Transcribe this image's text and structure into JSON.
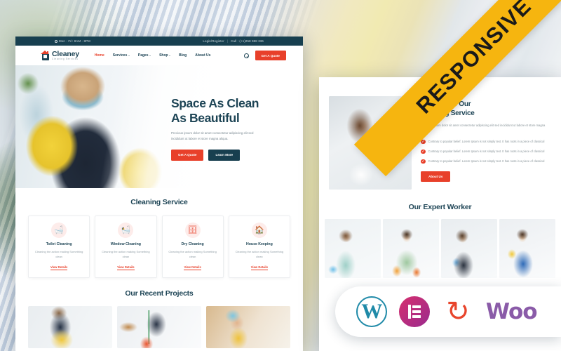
{
  "ribbon": {
    "label": "RESPONSIVE"
  },
  "topbar": {
    "hours": "Mon - Fri: 8AM - 8PM",
    "login": "Login/Register",
    "separator": "|",
    "call": "Call : (+1)258 988 336",
    "clock_icon": "clock-icon"
  },
  "header": {
    "logo_name": "Cleaney",
    "logo_sub": "Cleaning Services",
    "nav": [
      {
        "label": "Home",
        "active": true,
        "caret": false
      },
      {
        "label": "Services",
        "active": false,
        "caret": true
      },
      {
        "label": "Pages",
        "active": false,
        "caret": true
      },
      {
        "label": "Shop",
        "active": false,
        "caret": true
      },
      {
        "label": "Blog",
        "active": false,
        "caret": false
      },
      {
        "label": "About Us",
        "active": false,
        "caret": false
      }
    ],
    "search_icon": "search-icon",
    "quote_button": "Get A Quote"
  },
  "hero": {
    "title_line1": "Space As Clean",
    "title_line2": "As Beautiful",
    "paragraph": "Previous ipsum dolor sit amet consectetur adipiscing elit sed incididunt ut labore et store magna aliqua.",
    "primary_button": "Get A Quote",
    "secondary_button": "Learn More"
  },
  "services": {
    "title": "Cleaning Service",
    "cards": [
      {
        "title": "Toilet Cleaning",
        "icon": "bathtub-icon",
        "glyph": "Ὤ1",
        "desc": "Cleaning the action making Something clean",
        "link": "View Details"
      },
      {
        "title": "Window Cleaning",
        "icon": "bucket-icon",
        "glyph": "Ὤ0",
        "desc": "Cleaning the action making Something clean",
        "link": "View Details"
      },
      {
        "title": "Dry Cleaning",
        "icon": "washing-machine-icon",
        "glyph": "Ὕ4",
        "desc": "Cleaning the action making Something clean",
        "link": "View Details"
      },
      {
        "title": "House Keeping",
        "icon": "house-icon",
        "glyph": "Ἶ0",
        "desc": "Cleaning the action making Something clean",
        "link": "View Details"
      }
    ]
  },
  "projects": {
    "title": "Our Recent Projects",
    "items": [
      {
        "alt": "woman cleaning with yellow gloves"
      },
      {
        "alt": "person mopping with bucket"
      },
      {
        "alt": "tired woman in kitchen wiping brow"
      }
    ]
  },
  "about": {
    "title_line1": "We Provide Our",
    "title_line2": "Cleaning Service",
    "paragraph": "Previous ipsum dolor sit amet consectetur adipiscing elit sed incididunt ut labore et store magna aliqua.",
    "photo_alt": "smiling woman holding orange cloth",
    "bullets": [
      "Contrary to popular belief. Lorem Ipsum is not simply text. It has roots in a piece of classical",
      "Contrary to popular belief. Lorem Ipsum is not simply text. It has roots in a piece of classical",
      "Contrary to popular belief. Lorem Ipsum is not simply text. It has roots in a piece of classical"
    ],
    "button": "About Us"
  },
  "workers": {
    "title": "Our Expert Worker",
    "items": [
      {
        "alt": "female worker in teal apron"
      },
      {
        "alt": "male worker with cleaning supplies"
      },
      {
        "alt": "female worker with spray bottle"
      },
      {
        "alt": "male worker in blue apron"
      }
    ]
  },
  "badges": {
    "items": [
      {
        "name": "wordpress-logo",
        "label": "W"
      },
      {
        "name": "elementor-logo",
        "label": "E"
      },
      {
        "name": "sync-logo",
        "label": "↻"
      },
      {
        "name": "woocommerce-logo",
        "label": "Woo"
      }
    ]
  },
  "colors": {
    "accent_red": "#e8402a",
    "dark_teal": "#173f4f",
    "heading": "#1d4455",
    "ribbon_yellow": "#f6b50f",
    "wordpress": "#1f8aa8",
    "elementor": "#9a2a8e",
    "woo": "#8a5ba8"
  }
}
